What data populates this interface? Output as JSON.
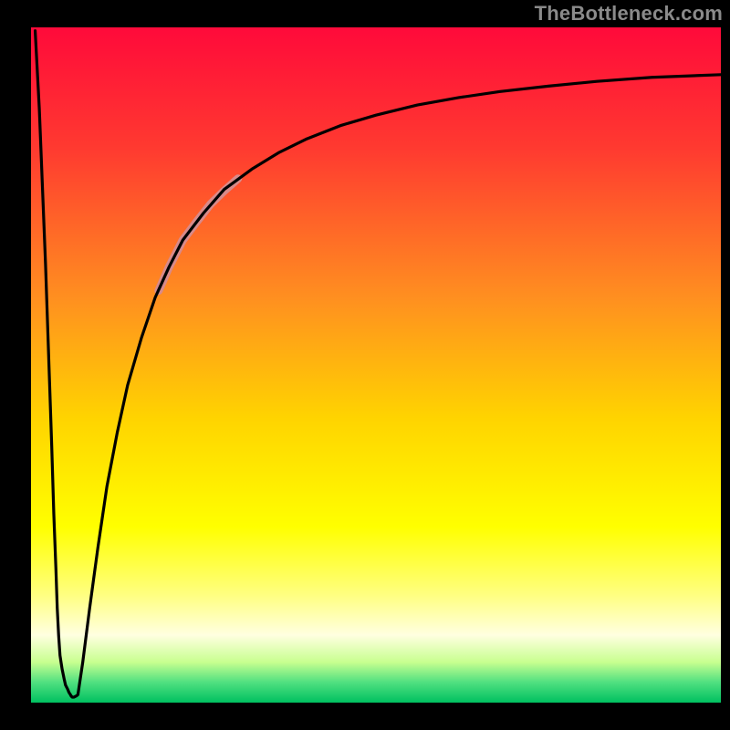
{
  "watermark": "TheBottleneck.com",
  "chart_data": {
    "type": "line",
    "title": "",
    "xlabel": "",
    "ylabel": "",
    "xlim": [
      0,
      100
    ],
    "ylim": [
      0,
      100
    ],
    "background_gradient_stops": [
      {
        "offset": 0.0,
        "color": "#ff0a3a"
      },
      {
        "offset": 0.18,
        "color": "#ff3a30"
      },
      {
        "offset": 0.4,
        "color": "#ff8f20"
      },
      {
        "offset": 0.58,
        "color": "#ffd400"
      },
      {
        "offset": 0.74,
        "color": "#ffff00"
      },
      {
        "offset": 0.84,
        "color": "#ffff80"
      },
      {
        "offset": 0.9,
        "color": "#ffffe0"
      },
      {
        "offset": 0.94,
        "color": "#c8ff90"
      },
      {
        "offset": 0.97,
        "color": "#50e080"
      },
      {
        "offset": 1.0,
        "color": "#00c060"
      }
    ],
    "series": [
      {
        "name": "left-spike",
        "stroke": "#000000",
        "x": [
          0.6,
          1.2,
          2.1,
          2.6,
          3.0,
          3.3,
          3.6,
          3.8,
          4.0,
          4.2,
          4.5,
          4.8,
          5.0,
          5.3,
          5.5,
          5.7,
          5.8,
          5.9
        ],
        "y": [
          99.5,
          88.0,
          65.0,
          50.0,
          38.0,
          28.0,
          20.0,
          14.0,
          10.0,
          7.0,
          5.0,
          3.5,
          2.6,
          2.0,
          1.5,
          1.2,
          1.0,
          0.9
        ]
      },
      {
        "name": "valley-bottom",
        "stroke": "#000000",
        "x": [
          5.9,
          6.0,
          6.2,
          6.4,
          6.6,
          6.8
        ],
        "y": [
          0.9,
          0.8,
          0.8,
          0.9,
          1.0,
          1.2
        ]
      },
      {
        "name": "rising-curve",
        "stroke": "#000000",
        "x": [
          6.8,
          7.5,
          8.5,
          9.7,
          11,
          12.5,
          14,
          16,
          18,
          20,
          22,
          25,
          28,
          32,
          36,
          40,
          45,
          50,
          56,
          62,
          68,
          75,
          82,
          90,
          100
        ],
        "y": [
          1.2,
          6,
          14,
          23,
          32,
          40,
          47,
          54,
          60,
          64.5,
          68.5,
          72.5,
          76,
          79,
          81.5,
          83.5,
          85.5,
          87,
          88.5,
          89.6,
          90.5,
          91.3,
          92,
          92.6,
          93.0
        ]
      },
      {
        "name": "highlight-band",
        "stroke": "#d88a8a",
        "width": 9,
        "x": [
          18.5,
          20,
          22,
          24,
          26,
          28,
          30
        ],
        "y": [
          61,
          64.5,
          68.5,
          71.2,
          73.8,
          75.8,
          77.6
        ]
      }
    ]
  }
}
